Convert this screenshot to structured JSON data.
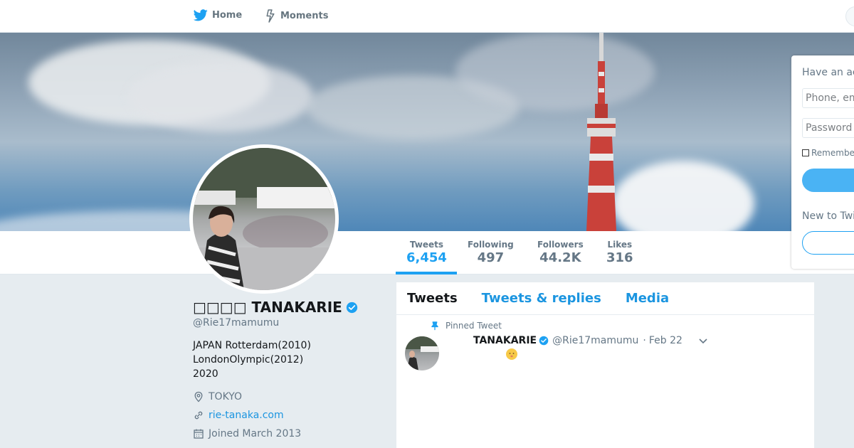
{
  "nav": {
    "home_label": "Home",
    "moments_label": "Moments"
  },
  "profile": {
    "name": "□□□□ TANAKARIE",
    "handle": "@Rie17mamumu",
    "bio": "JAPAN  Rotterdam(2010)\n LondonOlympic(2012)\n2020",
    "location": "TOKYO",
    "website": "rie-tanaka.com",
    "joined": "Joined March 2013",
    "verified": true
  },
  "stats": [
    {
      "label": "Tweets",
      "value": "6,454",
      "active": true
    },
    {
      "label": "Following",
      "value": "497",
      "active": false
    },
    {
      "label": "Followers",
      "value": "44.2K",
      "active": false
    },
    {
      "label": "Likes",
      "value": "316",
      "active": false
    }
  ],
  "timeline": {
    "tabs": [
      "Tweets",
      "Tweets & replies",
      "Media"
    ],
    "active_tab": "Tweets",
    "pinned_label": "Pinned Tweet",
    "tweet": {
      "name": "TANAKARIE",
      "handle": "@Rie17mamumu",
      "separator": "·",
      "date": "Feb 22"
    }
  },
  "login": {
    "heading": "Have an account?",
    "phone_placeholder": "Phone, email or username",
    "password_placeholder": "Password",
    "remember_label": "Remember me",
    "new_label": "New to Twitter?"
  },
  "colors": {
    "accent": "#1da1f2",
    "link": "#1b95e0",
    "background": "#e6ecf0"
  }
}
